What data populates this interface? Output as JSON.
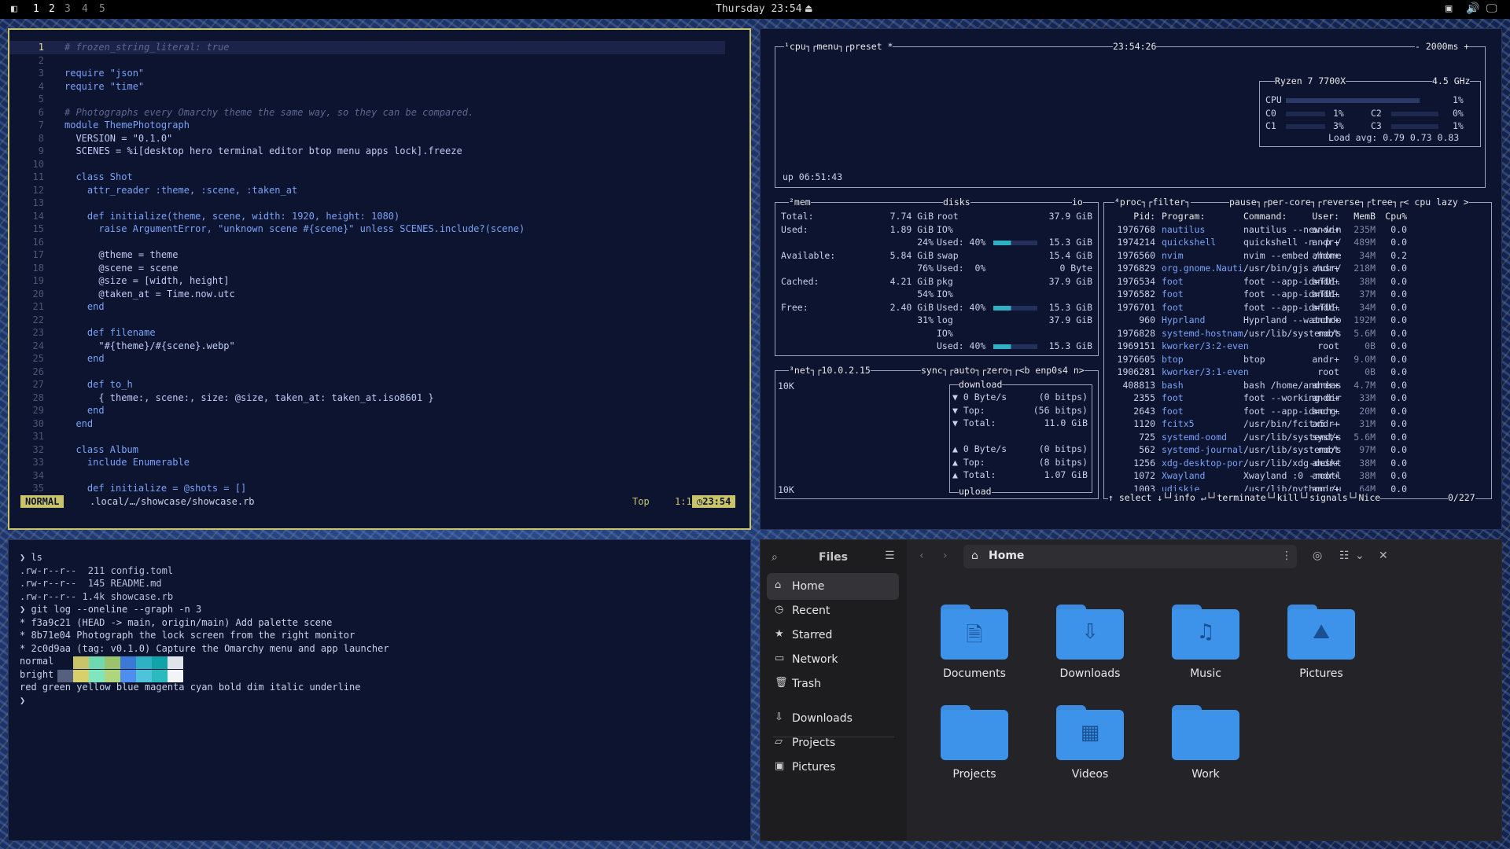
{
  "topbar": {
    "workspaces": [
      "1",
      "2",
      "3",
      "4",
      "5"
    ],
    "clock": "Thursday 23:54"
  },
  "editor": {
    "lines": [
      {
        "n": "1",
        "t": "# frozen_string_literal: true"
      },
      {
        "n": "2",
        "t": ""
      },
      {
        "n": "3",
        "t": "require \"json\""
      },
      {
        "n": "4",
        "t": "require \"time\""
      },
      {
        "n": "5",
        "t": ""
      },
      {
        "n": "6",
        "t": "# Photographs every Omarchy theme the same way, so they can be compared."
      },
      {
        "n": "7",
        "t": "module ThemePhotograph"
      },
      {
        "n": "8",
        "t": "  VERSION = \"0.1.0\""
      },
      {
        "n": "9",
        "t": "  SCENES = %i[desktop hero terminal editor btop menu apps lock].freeze"
      },
      {
        "n": "10",
        "t": ""
      },
      {
        "n": "11",
        "t": "  class Shot"
      },
      {
        "n": "12",
        "t": "    attr_reader :theme, :scene, :taken_at"
      },
      {
        "n": "13",
        "t": ""
      },
      {
        "n": "14",
        "t": "    def initialize(theme, scene, width: 1920, height: 1080)"
      },
      {
        "n": "15",
        "t": "      raise ArgumentError, \"unknown scene #{scene}\" unless SCENES.include?(scene)"
      },
      {
        "n": "16",
        "t": ""
      },
      {
        "n": "17",
        "t": "      @theme = theme"
      },
      {
        "n": "18",
        "t": "      @scene = scene"
      },
      {
        "n": "19",
        "t": "      @size = [width, height]"
      },
      {
        "n": "20",
        "t": "      @taken_at = Time.now.utc"
      },
      {
        "n": "21",
        "t": "    end"
      },
      {
        "n": "22",
        "t": ""
      },
      {
        "n": "23",
        "t": "    def filename"
      },
      {
        "n": "24",
        "t": "      \"#{theme}/#{scene}.webp\""
      },
      {
        "n": "25",
        "t": "    end"
      },
      {
        "n": "26",
        "t": ""
      },
      {
        "n": "27",
        "t": "    def to_h"
      },
      {
        "n": "28",
        "t": "      { theme:, scene:, size: @size, taken_at: taken_at.iso8601 }"
      },
      {
        "n": "29",
        "t": "    end"
      },
      {
        "n": "30",
        "t": "  end"
      },
      {
        "n": "31",
        "t": ""
      },
      {
        "n": "32",
        "t": "  class Album"
      },
      {
        "n": "33",
        "t": "    include Enumerable"
      },
      {
        "n": "34",
        "t": ""
      },
      {
        "n": "35",
        "t": "    def initialize = @shots = []"
      }
    ],
    "status": {
      "mode": "NORMAL",
      "file": ".local/…/showcase/showcase.rb",
      "top": "Top",
      "pos": "1:1",
      "time": "23:54"
    }
  },
  "btop": {
    "cpu": {
      "tabs": "¹cpu┐┌menu┐┌preset *",
      "clock": "23:54:26",
      "interval": "- 2000ms +",
      "uptime": "up 06:51:43",
      "model": "Ryzen 7 7700X",
      "freq": "4.5 GHz",
      "rows": [
        "CPU",
        "C0",
        "C1"
      ],
      "rows2": [
        "C2",
        "C3"
      ],
      "pct": [
        "1%",
        "1%",
        "3%"
      ],
      "pct2": [
        "0%",
        "1%"
      ],
      "load": "Load avg: 0.79 0.73 0.83"
    },
    "mem": {
      "title": "²mem",
      "rows": [
        {
          "k": "Total:",
          "v": "7.74 GiB"
        },
        {
          "k": "Used:",
          "v": "1.89 GiB"
        },
        {
          "k": "",
          "v": "24%"
        },
        {
          "k": "Available:",
          "v": "5.84 GiB"
        },
        {
          "k": "",
          "v": "76%"
        },
        {
          "k": "Cached:",
          "v": "4.21 GiB"
        },
        {
          "k": "",
          "v": "54%"
        },
        {
          "k": "Free:",
          "v": "2.40 GiB"
        },
        {
          "k": "",
          "v": "31%"
        }
      ]
    },
    "disks": {
      "title": "disks",
      "io": "io",
      "rows": [
        {
          "k": "root",
          "v": "37.9 GiB"
        },
        {
          "k": "IO%",
          "v": ""
        },
        {
          "k": "Used: 40%",
          "v": "15.3 GiB"
        },
        {
          "k": "swap",
          "v": "15.4 GiB"
        },
        {
          "k": "Used:  0%",
          "v": "0 Byte"
        },
        {
          "k": "pkg",
          "v": "37.9 GiB"
        },
        {
          "k": "IO%",
          "v": ""
        },
        {
          "k": "Used: 40%",
          "v": "15.3 GiB"
        },
        {
          "k": "log",
          "v": "37.9 GiB"
        },
        {
          "k": "IO%",
          "v": ""
        },
        {
          "k": "Used: 40%",
          "v": "15.3 GiB"
        }
      ]
    },
    "net": {
      "title": "³net┐┌10.0.2.15",
      "opts": "sync┐┌auto┐┌zero┐┌<b enp0s4 n>",
      "scale_top": "10K",
      "scale_bot": "10K",
      "download": "download",
      "upload": "upload",
      "rows": [
        {
          "k": "▼ 0 Byte/s",
          "v": "(0 bitps)"
        },
        {
          "k": "▼ Top:",
          "v": "(56 bitps)"
        },
        {
          "k": "▼ Total:",
          "v": "11.0 GiB"
        },
        {
          "k": "▲ 0 Byte/s",
          "v": "(0 bitps)"
        },
        {
          "k": "▲ Top:",
          "v": "(8 bitps)"
        },
        {
          "k": "▲ Total:",
          "v": "1.07 GiB"
        }
      ]
    },
    "proc": {
      "title": "⁴proc┐┌filter┐",
      "opts": "pause┐┌per-core┐┌reverse┐┌tree┐┌< cpu lazy >",
      "headers": [
        "Pid:",
        "Program:",
        "Command:",
        "User:",
        "MemB",
        "Cpu%"
      ],
      "rows": [
        [
          "1976768",
          "nautilus",
          "nautilus --new-win",
          "andr+",
          "235M",
          "0.0"
        ],
        [
          "1974214",
          "quickshell",
          "quickshell -n -p /",
          "andr+",
          "489M",
          "0.0"
        ],
        [
          "1976560",
          "nvim",
          "nvim --embed /home",
          "andr+",
          "34M",
          "0.2"
        ],
        [
          "1976829",
          "org.gnome.Nauti",
          "/usr/bin/gjs /usr/",
          "andr+",
          "218M",
          "0.0"
        ],
        [
          "1976534",
          "foot",
          "foot --app-id=TUI.",
          "andr+",
          "38M",
          "0.0"
        ],
        [
          "1976582",
          "foot",
          "foot --app-id=TUI.",
          "andr+",
          "37M",
          "0.0"
        ],
        [
          "1976701",
          "foot",
          "foot --app-id=TUI.",
          "andr+",
          "34M",
          "0.0"
        ],
        [
          "960",
          "Hyprland",
          "Hyprland --watchdo",
          "andr+",
          "192M",
          "0.0"
        ],
        [
          "1976828",
          "systemd-hostnam",
          "/usr/lib/systemd/s",
          "root",
          "5.6M",
          "0.0"
        ],
        [
          "1969151",
          "kworker/3:2-even",
          "",
          "root",
          "0B",
          "0.0"
        ],
        [
          "1976605",
          "btop",
          "btop",
          "andr+",
          "9.0M",
          "0.0"
        ],
        [
          "1906281",
          "kworker/3:1-even",
          "",
          "root",
          "0B",
          "0.0"
        ],
        [
          "408813",
          "bash",
          "bash /home/andreas",
          "andr+",
          "4.7M",
          "0.0"
        ],
        [
          "2355",
          "foot",
          "foot --working-dir",
          "andr+",
          "33M",
          "0.0"
        ],
        [
          "2643",
          "foot",
          "foot --app-id=org.",
          "andr+",
          "20M",
          "0.0"
        ],
        [
          "1120",
          "fcitx5",
          "/usr/bin/fcitx5 --",
          "andr+",
          "31M",
          "0.0"
        ],
        [
          "725",
          "systemd-oomd",
          "/usr/lib/systemd/s",
          "syst+",
          "5.6M",
          "0.0"
        ],
        [
          "562",
          "systemd-journal",
          "/usr/lib/systemd/s",
          "root",
          "97M",
          "0.0"
        ],
        [
          "1256",
          "xdg-desktop-por",
          "/usr/lib/xdg-deskt",
          "andr+",
          "38M",
          "0.0"
        ],
        [
          "1072",
          "Xwayland",
          "Xwayland :0 -rootl",
          "andr+",
          "38M",
          "0.0"
        ],
        [
          "1003",
          "udiskie",
          "/usr/lib/python /u",
          "andr+",
          "64M",
          "0.0"
        ]
      ],
      "footer": "↑ select ↓└┘info ↵└┘terminate└┘kill└┘signals└┘Nice",
      "count": "0/227"
    }
  },
  "term": {
    "lines": [
      "❯ ls",
      ".rw-r--r--  211 config.toml",
      ".rw-r--r--  145 README.md",
      ".rw-r--r-- 1.4k showcase.rb",
      "❯ git log --oneline --graph -n 3",
      "* f3a9c21 (HEAD -> main, origin/main) Add palette scene",
      "* 8b71e04 Photograph the lock screen from the right monitor",
      "* 2c0d9aa (tag: v0.1.0) Capture the Omarchy menu and app launcher",
      "normal",
      "bright",
      "red green yellow blue magenta cyan bold dim italic underline",
      "❯"
    ],
    "palette_normal": [
      "#0c1430",
      "#c9c46a",
      "#6fd9b0",
      "#9bc36b",
      "#3b78d8",
      "#2fb0c4",
      "#12a3a8",
      "#dfe4ea"
    ],
    "palette_bright": [
      "#55607f",
      "#d8d06a",
      "#7fe6bd",
      "#b0d57a",
      "#4f8eee",
      "#4fc3d9",
      "#2bbbbf",
      "#f2f4f8"
    ]
  },
  "files": {
    "title": "Files",
    "location": "Home",
    "sidebar": [
      {
        "label": "Home",
        "icon": "home-icon",
        "glyph": "⌂"
      },
      {
        "label": "Recent",
        "icon": "clock-icon",
        "glyph": "◷"
      },
      {
        "label": "Starred",
        "icon": "star-icon",
        "glyph": "★"
      },
      {
        "label": "Network",
        "icon": "network-icon",
        "glyph": "▭"
      },
      {
        "label": "Trash",
        "icon": "trash-icon",
        "glyph": "🗑"
      },
      {
        "label": "Downloads",
        "icon": "download-icon",
        "glyph": "⇩"
      },
      {
        "label": "Projects",
        "icon": "folder-icon",
        "glyph": "▱"
      },
      {
        "label": "Pictures",
        "icon": "image-icon",
        "glyph": "▣"
      }
    ],
    "folders": [
      {
        "label": "Documents",
        "glyph": "🗎"
      },
      {
        "label": "Downloads",
        "glyph": "⇩"
      },
      {
        "label": "Music",
        "glyph": "♫"
      },
      {
        "label": "Pictures",
        "glyph": "⛰"
      },
      {
        "label": "Projects",
        "glyph": ""
      },
      {
        "label": "Videos",
        "glyph": "▦"
      },
      {
        "label": "Work",
        "glyph": ""
      }
    ],
    "colors": {
      "folder": "#3d93ea"
    }
  }
}
